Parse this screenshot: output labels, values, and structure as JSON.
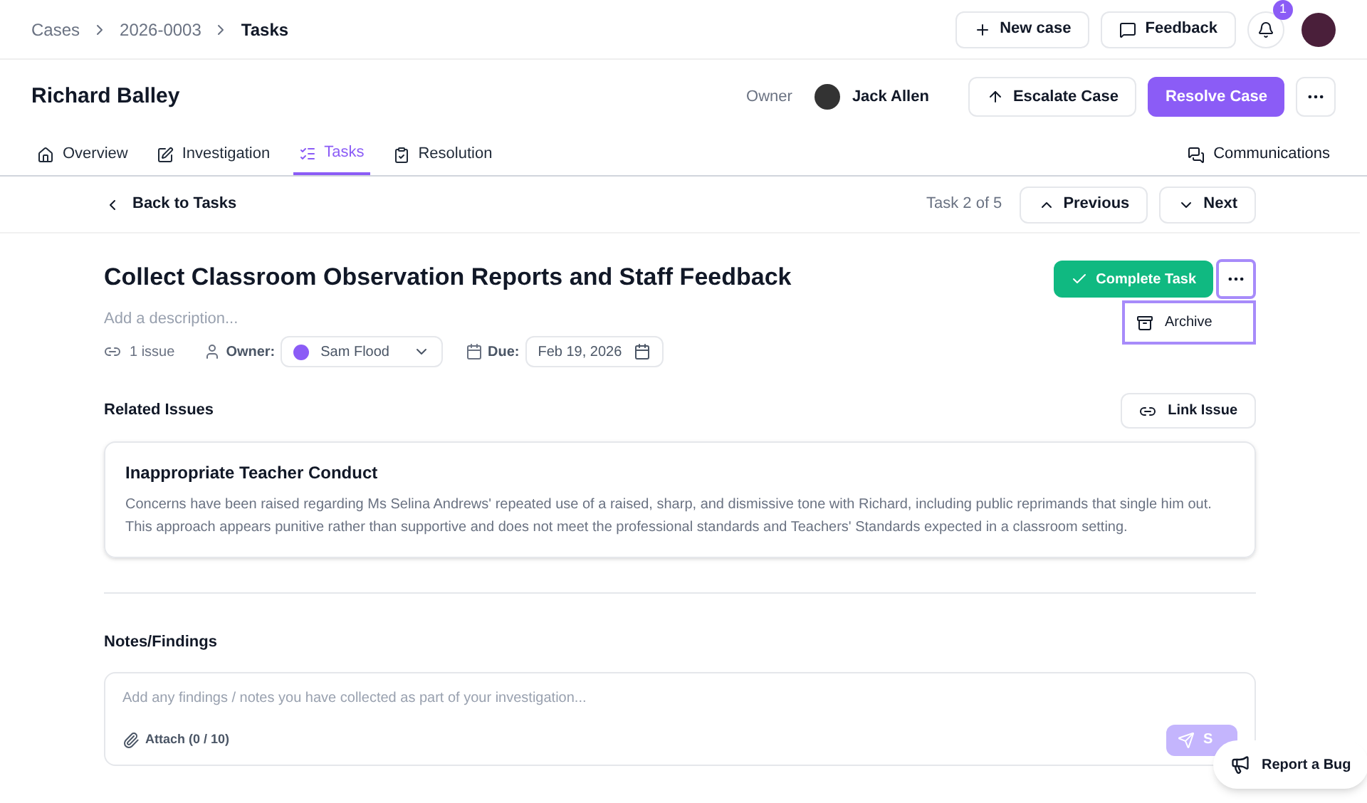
{
  "breadcrumbs": [
    {
      "label": "Cases",
      "selected": false
    },
    {
      "label": "2026-0003",
      "selected": false
    },
    {
      "label": "Tasks",
      "selected": true
    }
  ],
  "top_actions": {
    "new_case": "New case",
    "feedback": "Feedback",
    "notifications": "1"
  },
  "case": {
    "name": "Richard Balley",
    "owner_label": "Owner",
    "owner": "Jack Allen",
    "escalate": "Escalate Case",
    "resolve": "Resolve Case"
  },
  "tabs": [
    {
      "label": "Overview",
      "selected": false,
      "kind": "home"
    },
    {
      "label": "Investigation",
      "selected": false,
      "kind": "edit"
    },
    {
      "label": "Tasks",
      "selected": true,
      "kind": "list"
    },
    {
      "label": "Resolution",
      "selected": false,
      "kind": "clipboard"
    }
  ],
  "communications": "Communications",
  "task_nav": {
    "back": "Back to Tasks",
    "position": "Task 2 of 5",
    "previous": "Previous",
    "next": "Next"
  },
  "task": {
    "title": "Collect Classroom Observation Reports and Staff Feedback",
    "description_placeholder": "Add a description...",
    "complete": "Complete Task",
    "menu_open": true,
    "menu_items": [
      "Archive"
    ],
    "issues": "1 issue",
    "owner_label": "Owner:",
    "owner": "Sam Flood",
    "due_label": "Due:",
    "due": "Feb 19, 2026"
  },
  "related": {
    "title": "Related Issues",
    "link": "Link Issue",
    "issues": [
      {
        "title": "Inappropriate Teacher Conduct",
        "body": "Concerns have been raised regarding Ms Selina Andrews' repeated use of a raised, sharp, and dismissive tone with Richard, including public reprimands that single him out. This approach appears punitive rather than supportive and does not meet the professional standards and Teachers' Standards expected in a classroom setting."
      }
    ]
  },
  "notes": {
    "title": "Notes/Findings",
    "placeholder": "Add any findings / notes you have collected as part of your investigation...",
    "attach": "Attach (0 / 10)",
    "send": "S"
  },
  "report_bug": "Report a Bug"
}
